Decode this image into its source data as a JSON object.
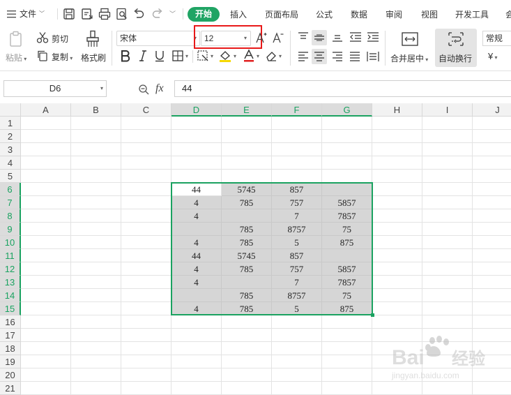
{
  "menubar": {
    "file_label": "文件",
    "tabs": [
      "开始",
      "插入",
      "页面布局",
      "公式",
      "数据",
      "审阅",
      "视图",
      "开发工具",
      "会"
    ],
    "active_tab": "开始"
  },
  "ribbon": {
    "paste_label": "粘贴",
    "cut_label": "剪切",
    "copy_label": "复制",
    "format_painter_label": "格式刷",
    "font_name": "宋体",
    "font_size": "12",
    "merge_label": "合并居中",
    "wrap_label": "自动换行",
    "number_format": "常规",
    "currency_symbol": "¥"
  },
  "formula_bar": {
    "cell_ref": "D6",
    "fx_label": "fx",
    "value": "44"
  },
  "sheet": {
    "columns": [
      "A",
      "B",
      "C",
      "D",
      "E",
      "F",
      "G",
      "H",
      "I",
      "J"
    ],
    "rows": [
      "1",
      "2",
      "3",
      "4",
      "5",
      "6",
      "7",
      "8",
      "9",
      "10",
      "11",
      "12",
      "13",
      "14",
      "15",
      "16",
      "17",
      "18",
      "19",
      "20",
      "21"
    ],
    "cells": {
      "D6": "44",
      "E6": "5745",
      "F6": "857",
      "G6": "",
      "D7": "4",
      "E7": "785",
      "F7": "757",
      "G7": "5857",
      "D8": "4",
      "E8": "",
      "F8": "7",
      "G8": "7857",
      "D9": "",
      "E9": "785",
      "F9": "8757",
      "G9": "75",
      "D10": "4",
      "E10": "785",
      "F10": "5",
      "G10": "875",
      "D11": "44",
      "E11": "5745",
      "F11": "857",
      "G11": "",
      "D12": "4",
      "E12": "785",
      "F12": "757",
      "G12": "5857",
      "D13": "4",
      "E13": "",
      "F13": "7",
      "G13": "7857",
      "D14": "",
      "E14": "785",
      "F14": "8757",
      "G14": "75",
      "D15": "4",
      "E15": "785",
      "F15": "5",
      "G15": "875"
    }
  },
  "watermark": {
    "brand": "Bai",
    "brand_suffix": "经验",
    "url": "jingyan.baidu.com"
  },
  "colors": {
    "accent": "#1aa260",
    "highlight": "#e81919",
    "selection_fill": "#d6d6d6"
  }
}
